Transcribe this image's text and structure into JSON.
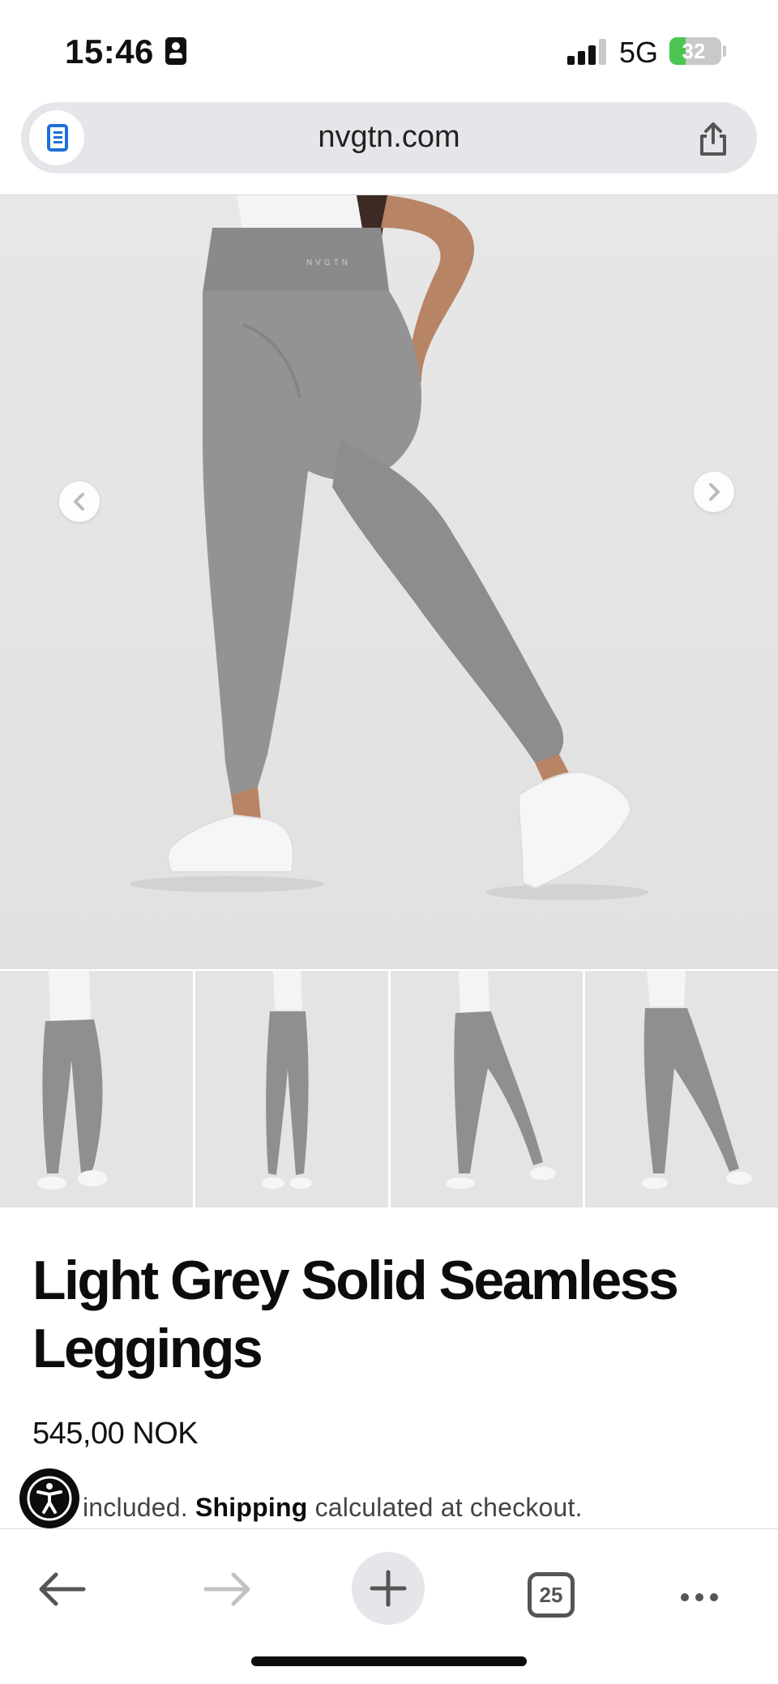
{
  "status_bar": {
    "time": "15:46",
    "network": "5G",
    "battery": "32",
    "battery_level": 0.32,
    "icons": [
      "contact-card-icon",
      "cellular-signal-icon",
      "battery-charging-icon"
    ]
  },
  "browser": {
    "url": "nvgtn.com",
    "icons": [
      "reader-view-icon",
      "share-icon"
    ]
  },
  "gallery": {
    "brand_mark": "NVGTN",
    "thumbnail_count": 4,
    "icons": [
      "chevron-left-icon",
      "chevron-right-icon"
    ]
  },
  "product": {
    "title": "Light Grey Solid Seamless Leggings",
    "price": "545,00 NOK",
    "tax_prefix": "included.",
    "shipping_link": "Shipping",
    "shipping_suffix": "calculated at checkout."
  },
  "toolbar": {
    "tabs_count": "25",
    "icons": [
      "back-arrow-icon",
      "forward-arrow-icon",
      "plus-icon",
      "tabs-icon",
      "more-icon"
    ]
  },
  "colors": {
    "accent_blue": "#1f6fd8",
    "battery_green": "#4cc553",
    "leggings_grey": "#8f8f8f"
  }
}
